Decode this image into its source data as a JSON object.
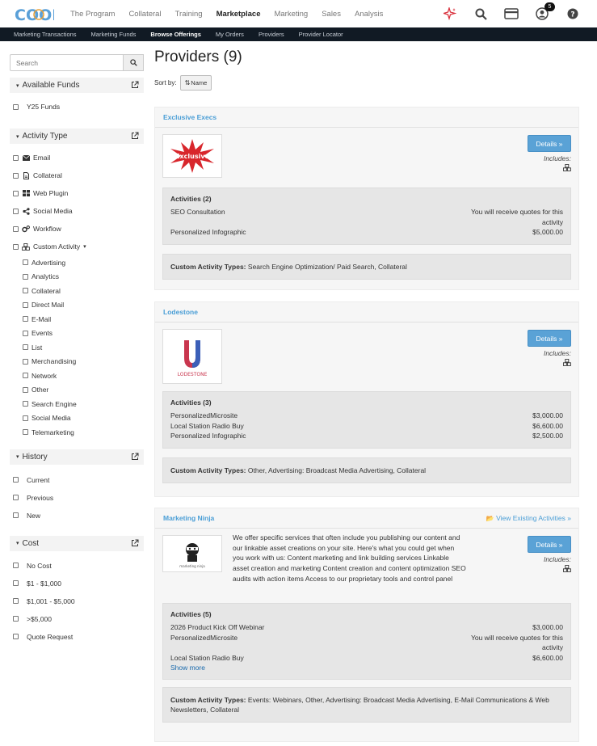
{
  "nav": {
    "logo": "COOP",
    "items": [
      {
        "label": "The Program",
        "active": false
      },
      {
        "label": "Collateral",
        "active": false
      },
      {
        "label": "Training",
        "active": false
      },
      {
        "label": "Marketplace",
        "active": true
      },
      {
        "label": "Marketing",
        "active": false
      },
      {
        "label": "Sales",
        "active": false
      },
      {
        "label": "Analysis",
        "active": false
      }
    ],
    "notification_count": "5"
  },
  "subnav": {
    "items": [
      {
        "label": "Marketing Transactions",
        "active": false
      },
      {
        "label": "Marketing Funds",
        "active": false
      },
      {
        "label": "Browse Offerings",
        "active": true
      },
      {
        "label": "My Orders",
        "active": false
      },
      {
        "label": "Providers",
        "active": false
      },
      {
        "label": "Provider Locator",
        "active": false
      }
    ]
  },
  "sidebar": {
    "search_placeholder": "Search",
    "funds": {
      "title": "Available Funds",
      "items": [
        "Y25 Funds"
      ]
    },
    "activity": {
      "title": "Activity Type",
      "items": [
        {
          "label": "Email",
          "icon": "envelope-icon"
        },
        {
          "label": "Collateral",
          "icon": "document-icon"
        },
        {
          "label": "Web Plugin",
          "icon": "grid-icon"
        },
        {
          "label": "Social Media",
          "icon": "share-icon"
        },
        {
          "label": "Workflow",
          "icon": "cogs-icon"
        },
        {
          "label": "Custom Activity",
          "icon": "cubes-icon"
        }
      ],
      "custom_sub": [
        "Advertising",
        "Analytics",
        "Collateral",
        "Direct Mail",
        "E-Mail",
        "Events",
        "List",
        "Merchandising",
        "Network",
        "Other",
        "Search Engine",
        "Social Media",
        "Telemarketing"
      ]
    },
    "history": {
      "title": "History",
      "items": [
        "Current",
        "Previous",
        "New"
      ]
    },
    "cost": {
      "title": "Cost",
      "items": [
        "No Cost",
        "$1 - $1,000",
        "$1,001 - $5,000",
        ">$5,000",
        "Quote Request"
      ]
    }
  },
  "main": {
    "title": "Providers (9)",
    "sort_label": "Sort by:",
    "sort_value": "Name",
    "details_label": "Details »",
    "includes_label": "Includes:",
    "view_existing": "View Existing Activities »",
    "cat_label": "Custom Activity Types:",
    "show_more": "Show more",
    "providers": [
      {
        "name": "Exclusive Execs",
        "logo_text": "Exclusive",
        "activities_title": "Activities (2)",
        "activities": [
          {
            "name": "SEO Consultation",
            "price": "You will receive quotes for this activity"
          },
          {
            "name": "Personalized Infographic",
            "price": "$5,000.00"
          }
        ],
        "custom_types": "Search Engine Optimization/ Paid Search, Collateral"
      },
      {
        "name": "Lodestone",
        "logo_text": "LODESTONE",
        "activities_title": "Activities (3)",
        "activities": [
          {
            "name": "PersonalizedMicrosite",
            "price": "$3,000.00"
          },
          {
            "name": "Local Station Radio Buy",
            "price": "$6,600.00"
          },
          {
            "name": "Personalized Infographic",
            "price": "$2,500.00"
          }
        ],
        "custom_types": "Other, Advertising: Broadcast Media Advertising, Collateral"
      },
      {
        "name": "Marketing Ninja",
        "logo_text": "marketing ninja",
        "description": "We offer specific services that often include you publishing our content and our linkable asset creations on your site. Here's what you could get when you work with us: Content marketing and link building services Linkable asset creation and marketing Content creation and content optimization SEO audits with action items Access to our proprietary tools and control panel",
        "activities_title": "Activities (5)",
        "activities": [
          {
            "name": "2026 Product Kick Off Webinar",
            "price": "$3,000.00"
          },
          {
            "name": "PersonalizedMicrosite",
            "price": "You will receive quotes for this activity"
          },
          {
            "name": "Local Station Radio Buy",
            "price": "$6,600.00"
          }
        ],
        "custom_types": "Events: Webinars, Other, Advertising: Broadcast Media Advertising, E-Mail Communications & Web Newsletters, Collateral"
      }
    ]
  }
}
